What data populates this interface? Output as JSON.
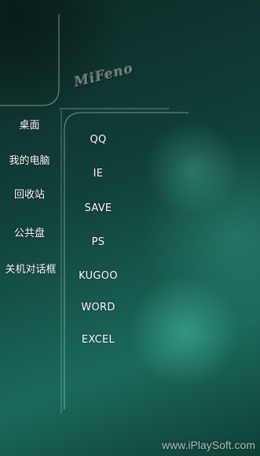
{
  "logo": {
    "text": "MiFeno"
  },
  "left_menu": {
    "items": [
      {
        "label": "桌面"
      },
      {
        "label": "我的电脑"
      },
      {
        "label": "回收站"
      },
      {
        "label": "公共盘"
      },
      {
        "label": "关机对话框"
      }
    ]
  },
  "right_menu": {
    "items": [
      {
        "label": "QQ"
      },
      {
        "label": "IE"
      },
      {
        "label": "SAVE"
      },
      {
        "label": "PS"
      },
      {
        "label": "KUGOO"
      },
      {
        "label": "WORD"
      },
      {
        "label": "EXCEL"
      }
    ]
  },
  "watermark": {
    "text": "www.iPlaySoft.com"
  }
}
